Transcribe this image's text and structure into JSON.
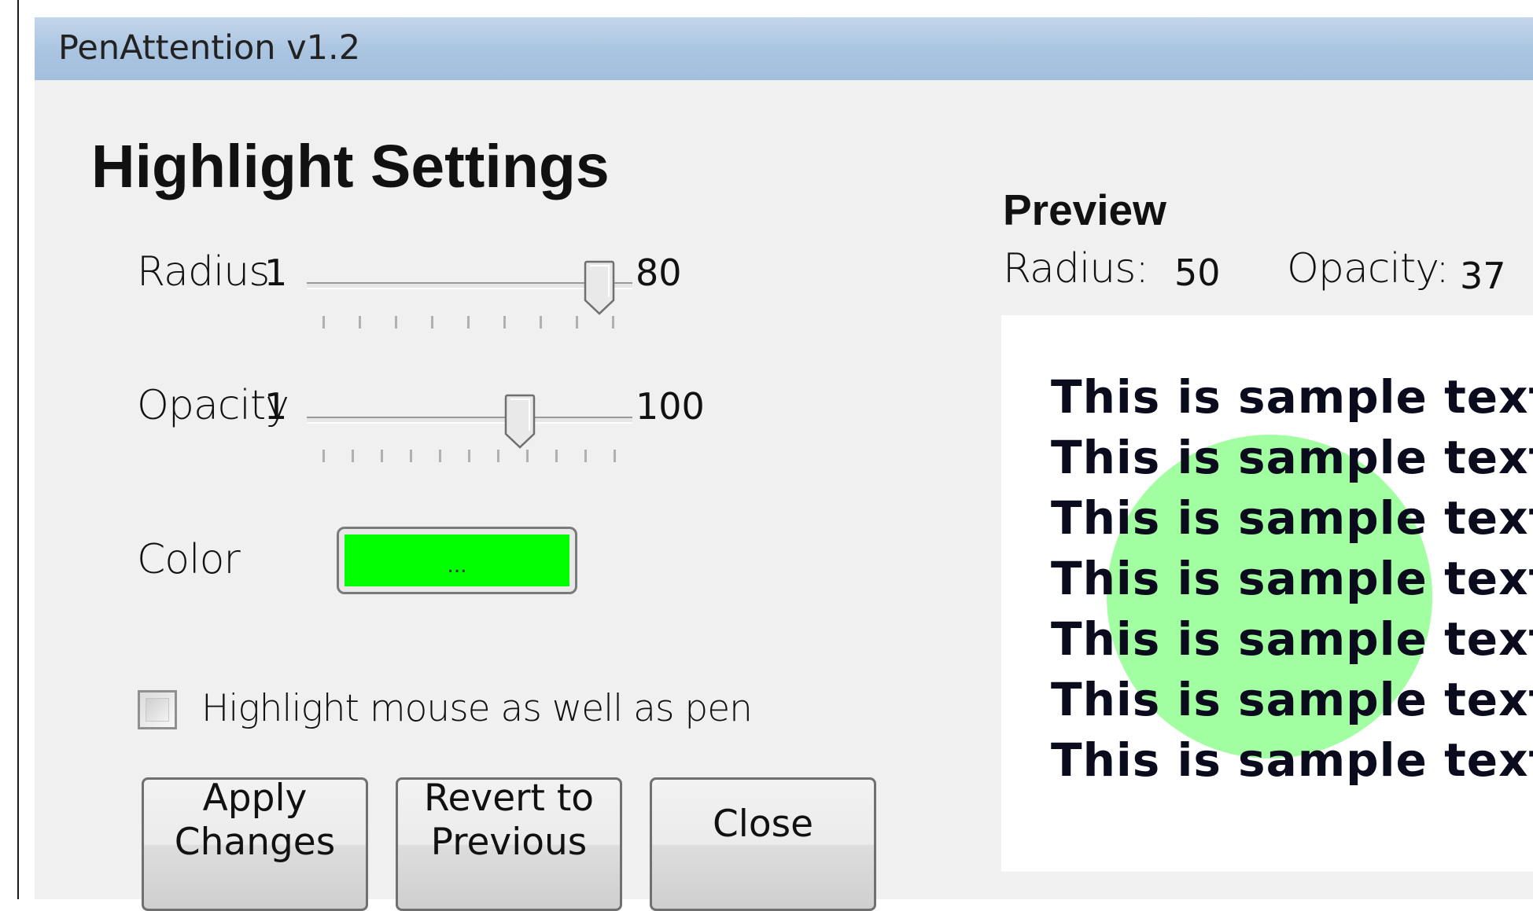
{
  "window": {
    "title": "PenAttention v1.2"
  },
  "settings": {
    "heading": "Highlight Settings",
    "radius": {
      "label": "Radius",
      "min": "1",
      "max": "80",
      "value": 50
    },
    "opacity": {
      "label": "Opacity",
      "min": "1",
      "max": "100",
      "value": 37
    },
    "color": {
      "label": "Color",
      "button_text": "...",
      "value": "#00ff00"
    },
    "checkbox": {
      "label": "Highlight mouse as well as pen",
      "checked": false
    }
  },
  "buttons": {
    "apply": "Apply\nChanges",
    "revert": "Revert to\nPrevious",
    "close": "Close"
  },
  "preview": {
    "title": "Preview",
    "radius_label": "Radius:",
    "radius_value": "50",
    "opacity_label": "Opacity:",
    "opacity_value": "37",
    "sample_lines": [
      "This is sample text",
      "This is sample text",
      "This is sample text",
      "This is sample text",
      "This is sample text",
      "This is sample text",
      "This is sample text"
    ]
  },
  "colors": {
    "titlebar": "#a9c4e1",
    "window_bg": "#f0f0f0",
    "highlight": "#00ff00"
  }
}
